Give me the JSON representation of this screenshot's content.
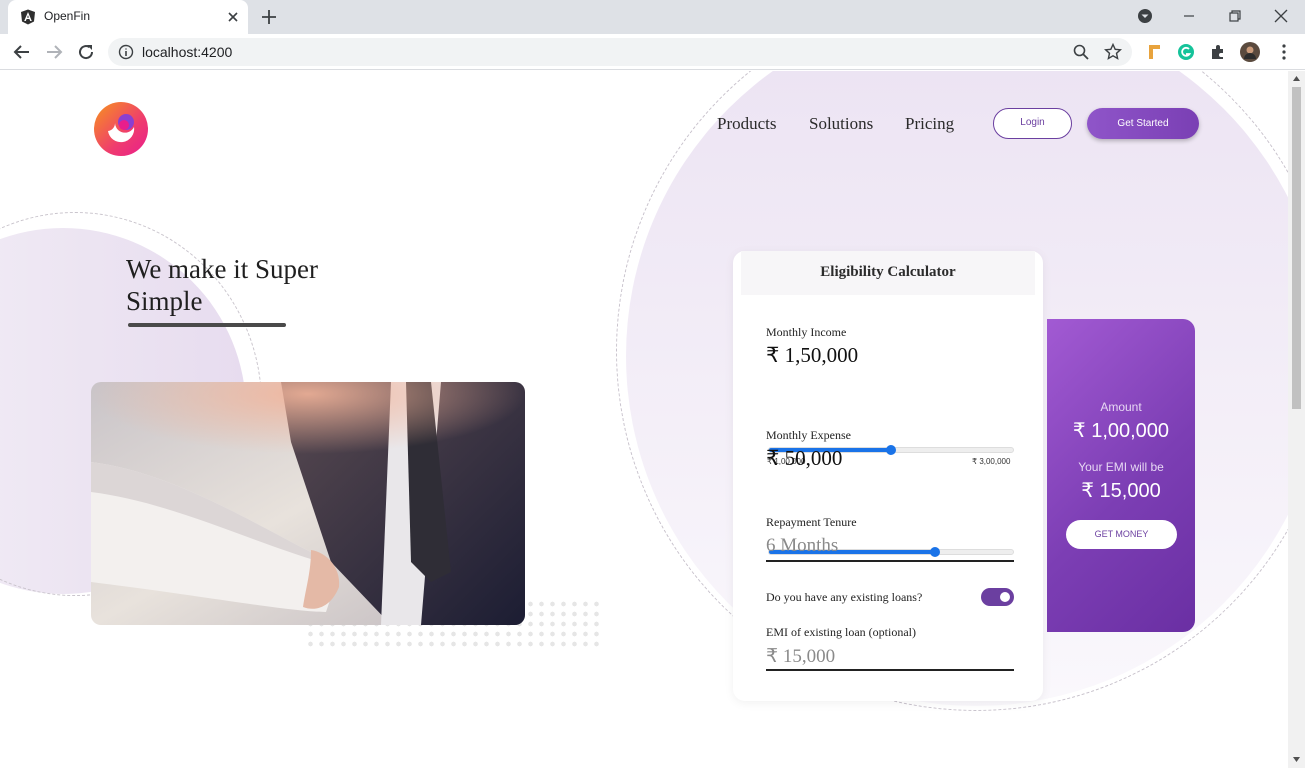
{
  "browser": {
    "tab_title": "OpenFin",
    "url": "localhost:4200"
  },
  "nav": {
    "links": [
      "Products",
      "Solutions",
      "Pricing"
    ],
    "login": "Login",
    "get_started": "Get Started"
  },
  "hero": {
    "title": "We make it Super Simple"
  },
  "calculator": {
    "title": "Eligibility Calculator",
    "income": {
      "label": "Monthly Income",
      "value": "₹ 1,50,000",
      "min_label": "₹ 1,00,000",
      "max_label": "₹ 3,00,000",
      "slider_fraction": 0.5
    },
    "expense": {
      "label": "Monthly Expense",
      "value": "₹ 50,000",
      "slider_fraction": 0.68
    },
    "tenure": {
      "label": "Repayment Tenure",
      "value": "6 Months"
    },
    "existing_loans": {
      "label": "Do you have any existing loans?",
      "enabled": true
    },
    "existing_emi": {
      "label": "EMI of existing loan (optional)",
      "value": "₹ 15,000"
    }
  },
  "result": {
    "amount_label": "Amount",
    "amount_value": "₹ 1,00,000",
    "emi_label": "Your EMI will be",
    "emi_value": "₹ 15,000",
    "button": "GET MONEY"
  },
  "colors": {
    "brand_purple": "#6b3fa0",
    "slider_blue": "#1a73e8"
  }
}
